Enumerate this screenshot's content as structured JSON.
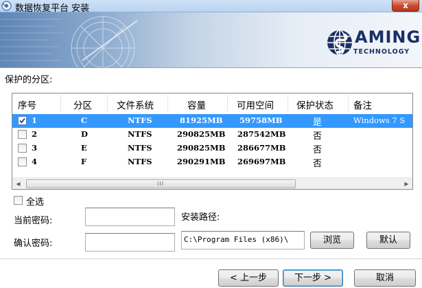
{
  "window": {
    "title": "数据恢复平台 安装",
    "close_label": "x"
  },
  "banner": {
    "logo_main": "AMING",
    "logo_sub": "TECHNOLOGY"
  },
  "protected_partitions_label": "保护的分区:",
  "table": {
    "columns": [
      "序号",
      "分区",
      "文件系统",
      "容量",
      "可用空间",
      "保护状态",
      "备注"
    ],
    "rows": [
      {
        "checked": true,
        "index": "1",
        "partition": "C",
        "fs": "NTFS",
        "capacity": "81925MB",
        "free": "59758MB",
        "status": "是",
        "note": "Windows 7 S",
        "selected": true
      },
      {
        "checked": false,
        "index": "2",
        "partition": "D",
        "fs": "NTFS",
        "capacity": "290825MB",
        "free": "287542MB",
        "status": "否",
        "note": "",
        "selected": false
      },
      {
        "checked": false,
        "index": "3",
        "partition": "E",
        "fs": "NTFS",
        "capacity": "290825MB",
        "free": "286677MB",
        "status": "否",
        "note": "",
        "selected": false
      },
      {
        "checked": false,
        "index": "4",
        "partition": "F",
        "fs": "NTFS",
        "capacity": "290291MB",
        "free": "269697MB",
        "status": "否",
        "note": "",
        "selected": false
      }
    ],
    "scroll_grip": "III",
    "scroll_left": "◀",
    "scroll_right": "▶"
  },
  "select_all_label": "全选",
  "current_password_label": "当前密码:",
  "confirm_password_label": "确认密码:",
  "current_password_value": "",
  "confirm_password_value": "",
  "install_path_label": "安装路径:",
  "install_path_value": "C:\\Program Files (x86)\\",
  "buttons": {
    "browse": "浏览",
    "default": "默认",
    "back": "< 上一步",
    "next": "下一步 >",
    "cancel": "取消"
  }
}
